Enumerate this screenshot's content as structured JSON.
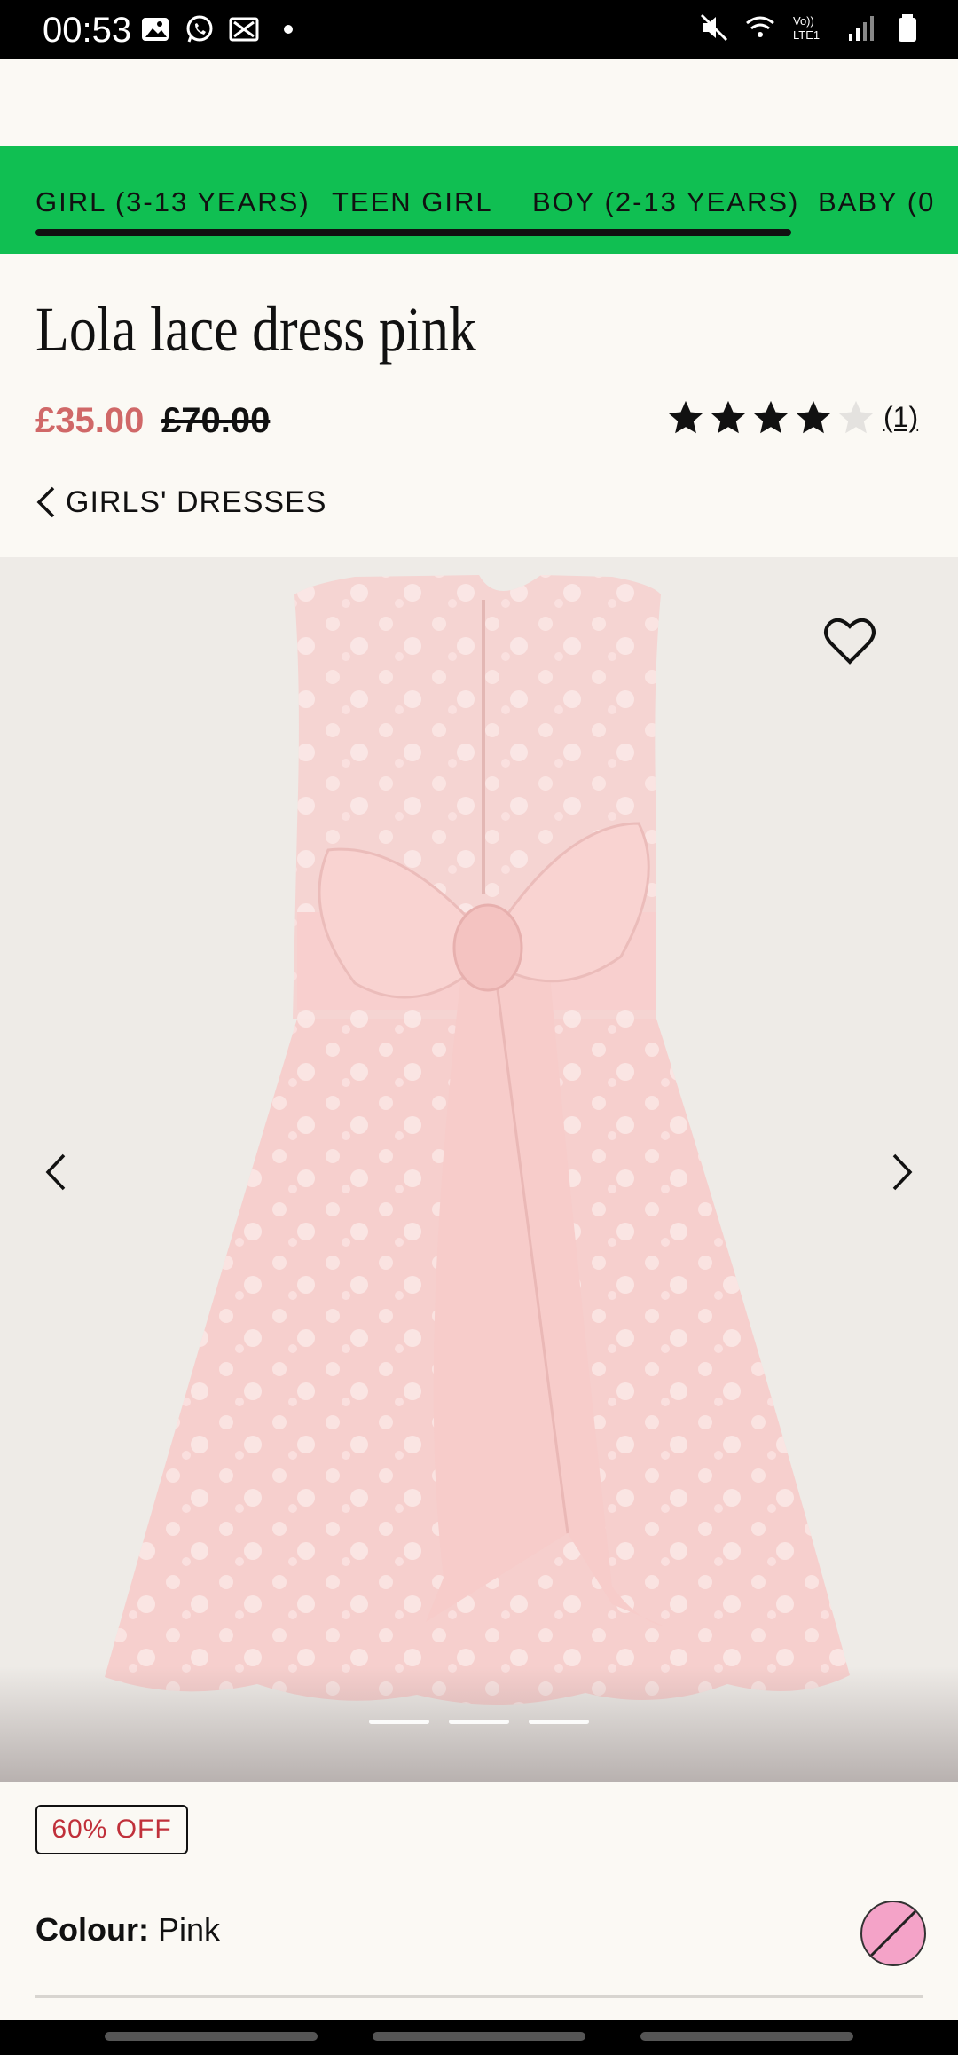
{
  "status_bar": {
    "time": "00:53",
    "left_icons": [
      "gallery-icon",
      "whatsapp-icon",
      "app-icon",
      "dot-icon"
    ],
    "right_icons": [
      "mute-icon",
      "wifi-icon",
      "volte-icon",
      "signal-icon",
      "battery-icon"
    ],
    "network_label": "Vo)) LTE1"
  },
  "category_nav": {
    "tabs": [
      {
        "label": "GIRL (3-13 YEARS)"
      },
      {
        "label": "TEEN GIRL"
      },
      {
        "label": "BOY (2-13 YEARS)"
      },
      {
        "label": "BABY (0"
      }
    ]
  },
  "product": {
    "title": "Lola lace dress pink",
    "price_current": "£35.00",
    "price_original": "£70.00",
    "rating": 4,
    "rating_max": 5,
    "review_count": "(1)",
    "breadcrumb": "GIRLS' DRESSES",
    "discount_badge": "60% OFF",
    "colour_label": "Colour:",
    "colour_value": "Pink"
  },
  "gallery": {
    "image_count": 3,
    "active_index": 1,
    "icons": [
      "heart-icon",
      "chevron-left-icon",
      "chevron-right-icon"
    ]
  },
  "colors": {
    "accent_green": "#10bf52",
    "price_red": "#d06868",
    "badge_red": "#c0303a",
    "swatch_pink": "#f4a3c8"
  }
}
